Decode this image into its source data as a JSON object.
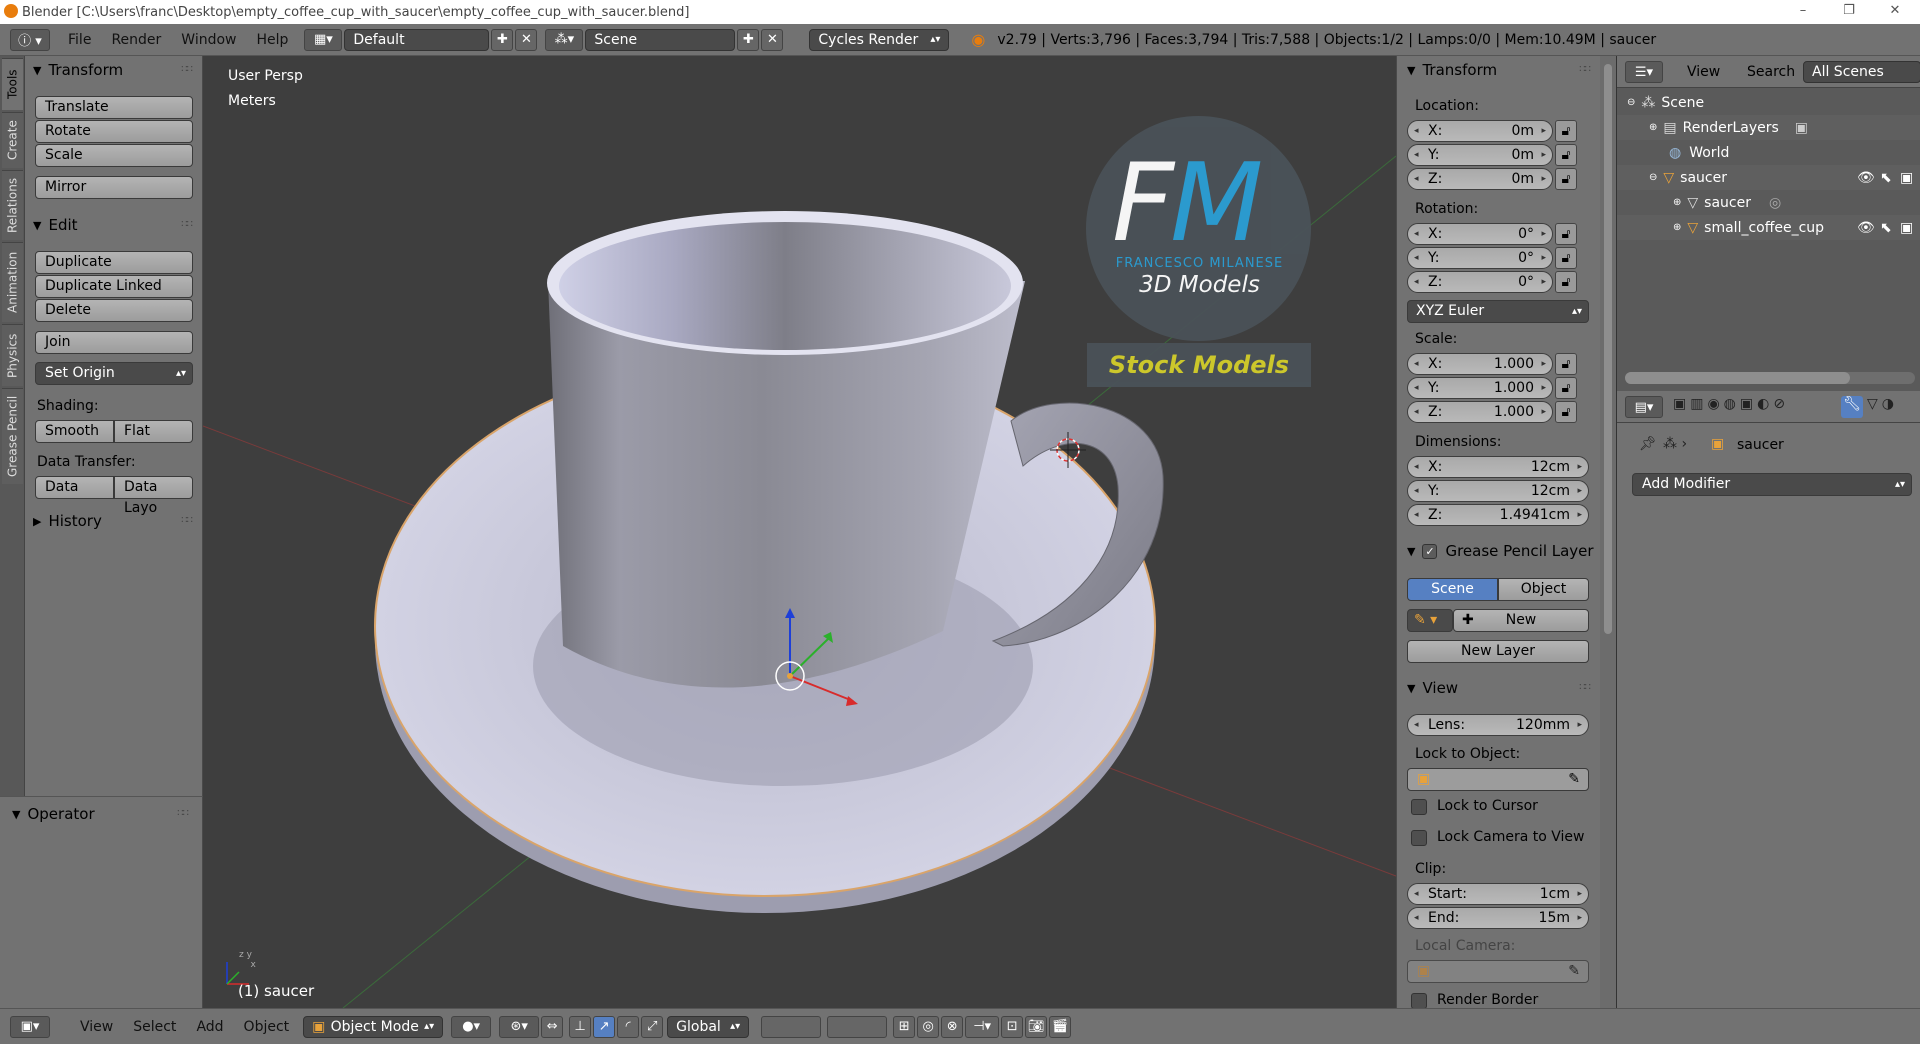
{
  "window": {
    "title": "Blender [C:\\Users\\franc\\Desktop\\empty_coffee_cup_with_saucer\\empty_coffee_cup_with_saucer.blend]",
    "controls": [
      "–",
      "❐",
      "✕"
    ]
  },
  "header": {
    "menus": [
      "File",
      "Render",
      "Window",
      "Help"
    ],
    "screen_layout": "Default",
    "scene": "Scene",
    "render_engine": "Cycles Render",
    "stats": "v2.79 | Verts:3,796 | Faces:3,794 | Tris:7,588 | Objects:1/2 | Lamps:0/0 | Mem:10.49M | saucer"
  },
  "tool_tabs": [
    "Tools",
    "Create",
    "Relations",
    "Animation",
    "Physics",
    "Grease Pencil"
  ],
  "toolshelf": {
    "transform": {
      "title": "Transform",
      "buttons": [
        "Translate",
        "Rotate",
        "Scale",
        "Mirror"
      ]
    },
    "edit": {
      "title": "Edit",
      "buttons": [
        "Duplicate",
        "Duplicate Linked",
        "Delete",
        "Join"
      ],
      "set_origin": "Set Origin",
      "shading_label": "Shading:",
      "smooth": "Smooth",
      "flat": "Flat",
      "data_transfer_label": "Data Transfer:",
      "data": "Data",
      "data_layout": "Data Layo"
    },
    "history": "History",
    "operator": "Operator"
  },
  "viewport": {
    "view_name": "User Persp",
    "units": "Meters",
    "object_label": "(1) saucer",
    "watermark": {
      "fm": "FM",
      "name": "FRANCESCO MILANESE",
      "models": "3D Models",
      "stock": "Stock Models"
    }
  },
  "npanel": {
    "transform_title": "Transform",
    "location_label": "Location:",
    "location": {
      "x": "0m",
      "y": "0m",
      "z": "0m"
    },
    "rotation_label": "Rotation:",
    "rotation": {
      "x": "0°",
      "y": "0°",
      "z": "0°"
    },
    "rotation_mode": "XYZ Euler",
    "scale_label": "Scale:",
    "scale": {
      "x": "1.000",
      "y": "1.000",
      "z": "1.000"
    },
    "dimensions_label": "Dimensions:",
    "dimensions": {
      "x": "12cm",
      "y": "12cm",
      "z": "1.4941cm"
    },
    "axis": {
      "x": "X:",
      "y": "Y:",
      "z": "Z:"
    },
    "grease_title": "Grease Pencil Layer",
    "grease_scene": "Scene",
    "grease_object": "Object",
    "grease_new": "New",
    "new_layer": "New Layer",
    "view_title": "View",
    "lens_label": "Lens:",
    "lens": "120mm",
    "lock_to_object": "Lock to Object:",
    "lock_to_cursor": "Lock to Cursor",
    "lock_camera": "Lock Camera to View",
    "clip_label": "Clip:",
    "clip_start_label": "Start:",
    "clip_start": "1cm",
    "clip_end_label": "End:",
    "clip_end": "15m",
    "local_camera": "Local Camera:",
    "render_border": "Render Border"
  },
  "outliner": {
    "view": "View",
    "search": "Search",
    "all_scenes": "All Scenes",
    "items": [
      "Scene",
      "RenderLayers",
      "World",
      "saucer",
      "saucer",
      "small_coffee_cup"
    ]
  },
  "properties": {
    "object_name": "saucer",
    "add_modifier": "Add Modifier"
  },
  "footer": {
    "menus": [
      "View",
      "Select",
      "Add",
      "Object"
    ],
    "mode": "Object Mode",
    "orientation": "Global"
  },
  "colors": {
    "active_blue": "#5680c2",
    "viewport_bg": "#3e3e3e",
    "panel_bg": "#727272",
    "stock_text": "#d4cf2b",
    "fm_blue": "#2a9fd6"
  }
}
